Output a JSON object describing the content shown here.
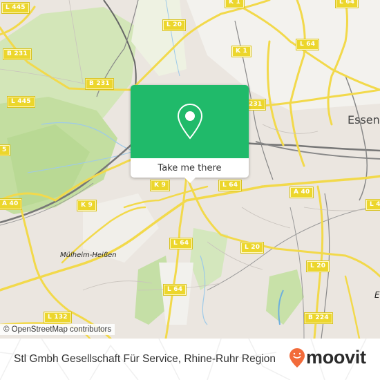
{
  "map": {
    "road_labels": [
      {
        "id": "l445-top",
        "text": "L 445"
      },
      {
        "id": "l20-top",
        "text": "L 20"
      },
      {
        "id": "k1-top",
        "text": "K 1"
      },
      {
        "id": "l64-top",
        "text": "L 64"
      },
      {
        "id": "b231-left",
        "text": "B 231"
      },
      {
        "id": "b231-mid",
        "text": "B 231"
      },
      {
        "id": "k1-mid",
        "text": "K 1"
      },
      {
        "id": "l64-ne",
        "text": "L 64"
      },
      {
        "id": "b231-east",
        "text": "231"
      },
      {
        "id": "l445-left",
        "text": "L 445"
      },
      {
        "id": "l5-left",
        "text": "5"
      },
      {
        "id": "a40-left",
        "text": "A 40"
      },
      {
        "id": "k9",
        "text": "K 9"
      },
      {
        "id": "k9-under",
        "text": "K 9"
      },
      {
        "id": "l64-center",
        "text": "L 64"
      },
      {
        "id": "a40-right",
        "text": "A 40"
      },
      {
        "id": "l4-right",
        "text": "L 4"
      },
      {
        "id": "l64-south",
        "text": "L 64"
      },
      {
        "id": "l20-center",
        "text": "L 20"
      },
      {
        "id": "l20-right",
        "text": "L 20"
      },
      {
        "id": "l64-bottom",
        "text": "L 64"
      },
      {
        "id": "l132",
        "text": "L 132"
      },
      {
        "id": "b224",
        "text": "B 224"
      }
    ],
    "place_labels": {
      "city": "Essen",
      "district": "Mülheim-Heißen",
      "city_edge": "E"
    },
    "attribution": "© OpenStreetMap contributors"
  },
  "popup": {
    "icon": "map-pin-icon",
    "button_label": "Take me there",
    "color": "#20ba6a"
  },
  "footer": {
    "title": "Stl Gmbh Gesellschaft Für Service, Rhine-Ruhr Region",
    "brand": "moovit",
    "brand_color": "#f26b3a"
  }
}
